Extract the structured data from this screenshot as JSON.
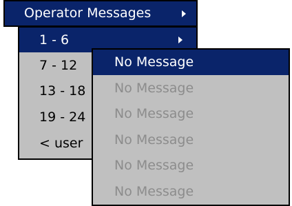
{
  "menu_top": {
    "label": "Operator Messages",
    "arrow_icon": "chevron-right-icon"
  },
  "menu_mid": {
    "items": [
      {
        "label": "1 - 6",
        "selected": true,
        "has_submenu": true
      },
      {
        "label": "7 - 12",
        "selected": false
      },
      {
        "label": "13 - 18",
        "selected": false
      },
      {
        "label": "19 - 24",
        "selected": false
      },
      {
        "label": "< user",
        "selected": false
      }
    ]
  },
  "menu_sub": {
    "items": [
      {
        "label": "No Message",
        "state": "selected"
      },
      {
        "label": "No Message",
        "state": "disabled"
      },
      {
        "label": "No Message",
        "state": "disabled"
      },
      {
        "label": "No Message",
        "state": "disabled"
      },
      {
        "label": "No Message",
        "state": "disabled"
      },
      {
        "label": "No Message",
        "state": "disabled"
      }
    ]
  },
  "colors": {
    "highlight": "#0a246a",
    "menu_bg": "#c0c0c0",
    "disabled_text": "#8c8c8c"
  }
}
